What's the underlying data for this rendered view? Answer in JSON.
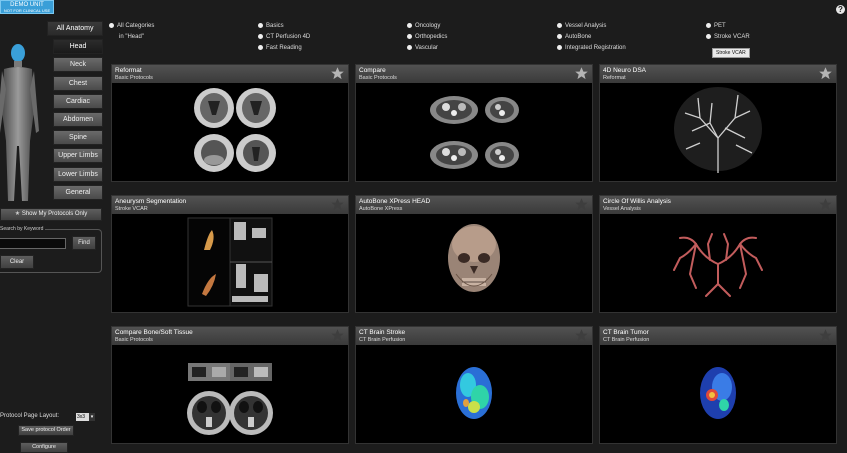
{
  "badge": {
    "line1": "DEMO UNIT",
    "line2": "NOT FOR CLINICAL USE"
  },
  "help_label": "?",
  "anatomy": {
    "all": "All Anatomy",
    "items": [
      "Head",
      "Neck",
      "Chest",
      "Cardiac",
      "Abdomen",
      "Spine",
      "Upper Limbs",
      "Lower Limbs",
      "General"
    ],
    "selected": "Head"
  },
  "left_panel": {
    "show_my_protocols": "Show My Protocols Only",
    "search_label": "Search by Keyword",
    "find": "Find",
    "clear": "Clear",
    "layout_label": "Protocol Page Layout:",
    "layout_value": "3x3",
    "save_order": "Save protocol Order",
    "configure": "Configure"
  },
  "categories": {
    "all_line1": "All Categories",
    "all_line2": "in \"Head\"",
    "items": [
      "Basics",
      "CT Perfusion 4D",
      "Fast Reading",
      "Oncology",
      "Orthopedics",
      "Vascular",
      "Vessel Analysis",
      "AutoBone",
      "Integrated Registration",
      "PET",
      "Stroke VCAR"
    ],
    "tooltip": "Stroke VCAR"
  },
  "protocols": [
    {
      "title": "Reformat",
      "subtitle": "Basic Protocols",
      "favorite": true
    },
    {
      "title": "Compare",
      "subtitle": "Basic Protocols",
      "favorite": true
    },
    {
      "title": "4D Neuro DSA",
      "subtitle": "Reformat",
      "favorite": true
    },
    {
      "title": "Aneurysm Segmentation",
      "subtitle": "Stroke VCAR",
      "favorite": false
    },
    {
      "title": "AutoBone XPress HEAD",
      "subtitle": "AutoBone XPress",
      "favorite": false
    },
    {
      "title": "Circle Of Willis Analysis",
      "subtitle": "Vessel Analysis",
      "favorite": false
    },
    {
      "title": "Compare Bone/Soft Tissue",
      "subtitle": "Basic Protocols",
      "favorite": false
    },
    {
      "title": "CT Brain Stroke",
      "subtitle": "CT Brain Perfusion",
      "favorite": false
    },
    {
      "title": "CT Brain Tumor",
      "subtitle": "CT Brain Perfusion",
      "favorite": false
    }
  ],
  "colors": {
    "accent": "#3a9fd8",
    "panel": "#1c1c1c",
    "card_header": "#484848",
    "star_fav": "#b4b4b4",
    "star_off": "#3e3e3e"
  }
}
